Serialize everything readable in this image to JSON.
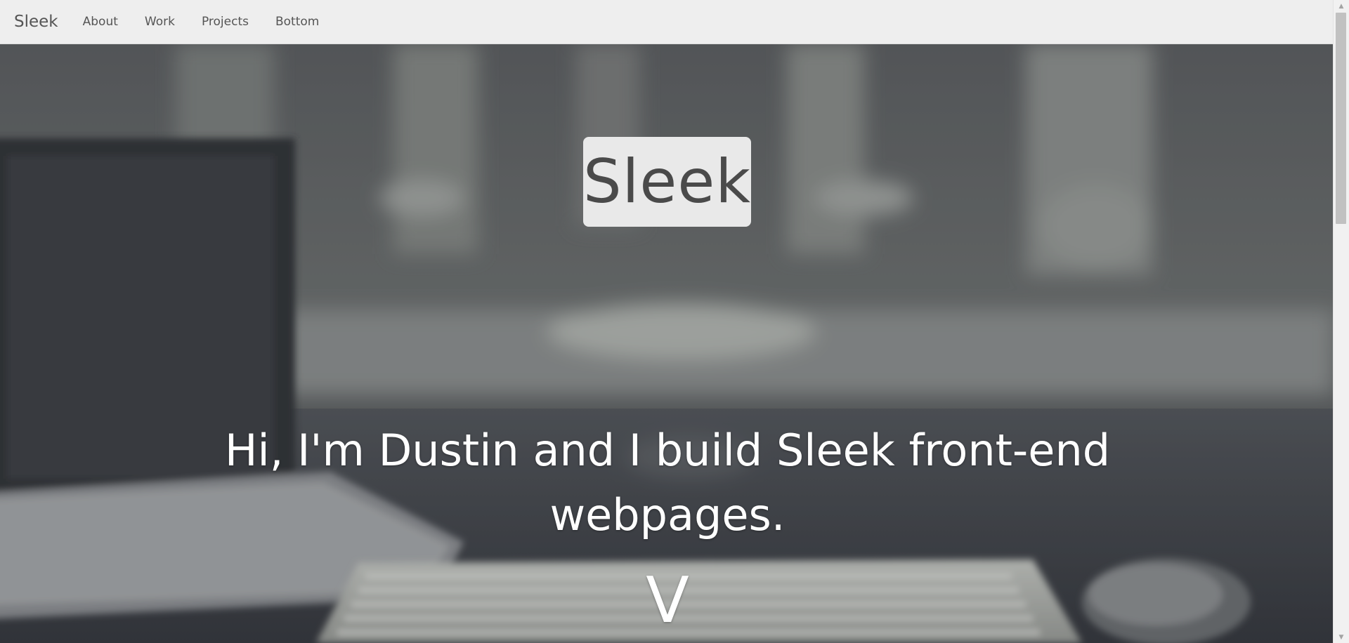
{
  "navbar": {
    "brand": "Sleek",
    "links": [
      "About",
      "Work",
      "Projects",
      "Bottom"
    ]
  },
  "hero": {
    "badge": "Sleek",
    "tagline": "Hi, I'm Dustin and I build Sleek front-end webpages.",
    "scroll_indicator": "V"
  },
  "colors": {
    "navbar_bg": "#eeeeee",
    "nav_text": "#555555",
    "badge_bg": "#e9e9e9",
    "badge_text": "#4a4a4a",
    "hero_text": "#ffffff"
  },
  "icons": {
    "scroll_up": "triangle-up-icon",
    "scroll_down": "triangle-down-icon"
  }
}
